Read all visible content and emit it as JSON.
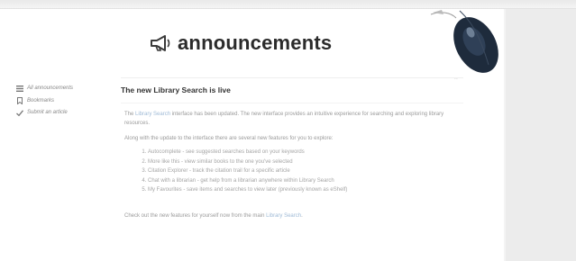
{
  "page": {
    "title": "announcements",
    "icon": "megaphone-icon"
  },
  "sidebar": {
    "items": [
      {
        "label": "All announcements",
        "icon": "list-icon"
      },
      {
        "label": "Bookmarks",
        "icon": "bookmark-icon"
      },
      {
        "label": "Submit an article",
        "icon": "check-icon"
      }
    ]
  },
  "post": {
    "title": "The new Library Search is live",
    "para1_pre": "The ",
    "para1_link": "Library Search",
    "para1_post": " interface has been updated. The new interface provides an intuitive experience for searching and exploring library resources.",
    "para2": "Along with the update to the interface there are several new features for you to explore:",
    "features": [
      "Autocomplete - see suggested searches based on your keywords",
      "More like this - view similar books to the one you've selected",
      "Citation Explorer - track the citation trail for a specific article",
      "Chat with a librarian - get help from a librarian anywhere within Library Search",
      "My Favourites - save items and searches to view later (previously known as eShelf)"
    ],
    "para3_pre": "Check out the new features for yourself now from the main ",
    "para3_link": "Library Search",
    "para3_post": "."
  },
  "colors": {
    "accent_link": "#9fbad6",
    "title_text": "#2b2b2b",
    "right_panel": "#ececec"
  }
}
